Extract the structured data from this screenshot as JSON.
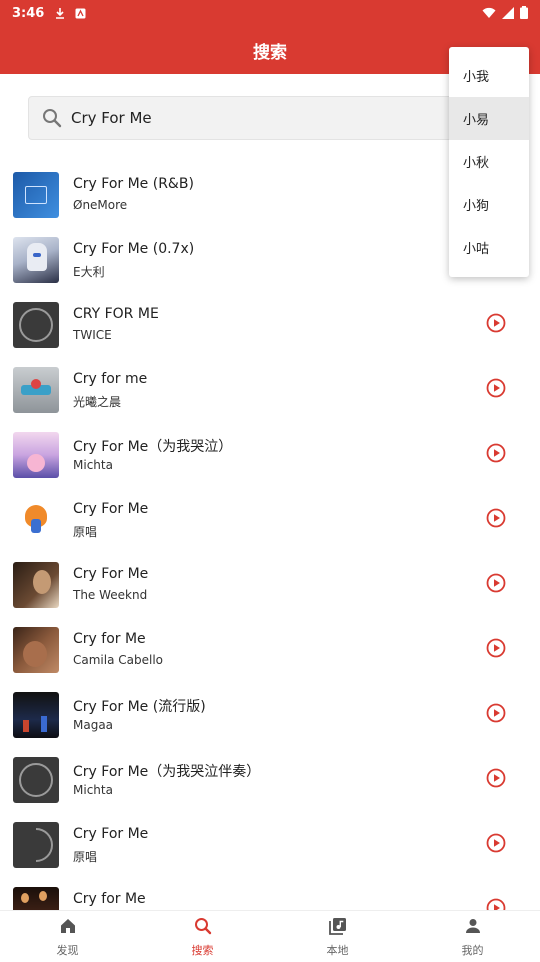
{
  "status": {
    "time": "3:46"
  },
  "appbar": {
    "title": "搜索"
  },
  "search": {
    "value": "Cry For Me"
  },
  "menu": {
    "items": [
      "小我",
      "小易",
      "小秋",
      "小狗",
      "小咕"
    ],
    "selected": 1
  },
  "songs": [
    {
      "title": "Cry For Me (R&B)",
      "artist": "ØneMore"
    },
    {
      "title": "Cry For Me (0.7x)",
      "artist": "E大利"
    },
    {
      "title": "CRY FOR ME",
      "artist": "TWICE"
    },
    {
      "title": "Cry for me",
      "artist": "光曦之晨"
    },
    {
      "title": "Cry For Me（为我哭泣）",
      "artist": "Michta"
    },
    {
      "title": "Cry For Me",
      "artist": "原唱"
    },
    {
      "title": "Cry For Me",
      "artist": "The Weeknd"
    },
    {
      "title": "Cry for Me",
      "artist": "Camila Cabello"
    },
    {
      "title": "Cry For Me (流行版)",
      "artist": "Magaa"
    },
    {
      "title": "Cry For Me（为我哭泣伴奏）",
      "artist": "Michta"
    },
    {
      "title": "Cry For Me",
      "artist": "原唱"
    },
    {
      "title": "Cry for Me",
      "artist": ""
    }
  ],
  "nav": {
    "tabs": [
      "发现",
      "搜索",
      "本地",
      "我的"
    ],
    "active": 1
  },
  "colors": {
    "accent": "#d93a31"
  }
}
